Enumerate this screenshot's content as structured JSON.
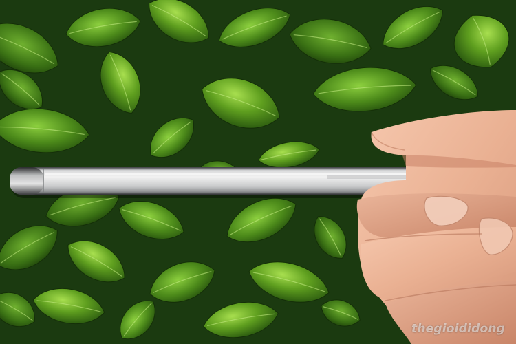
{
  "watermark": {
    "text": "thegioididong"
  }
}
